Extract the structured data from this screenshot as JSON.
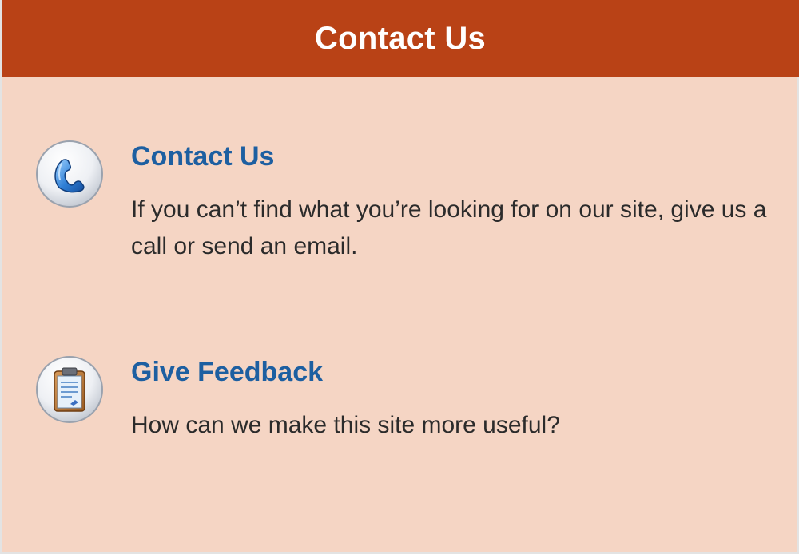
{
  "header": {
    "title": "Contact Us"
  },
  "items": [
    {
      "icon": "phone-icon",
      "title": "Contact Us",
      "text": "If you can’t find what you’re looking for on our site, give us a call or send an email."
    },
    {
      "icon": "clipboard-icon",
      "title": "Give Feedback",
      "text": "How can we make this site more useful?"
    }
  ],
  "colors": {
    "header_bg": "#b94216",
    "panel_bg": "#f5d5c4",
    "link": "#1d5fa1",
    "text": "#2b2b2b"
  }
}
